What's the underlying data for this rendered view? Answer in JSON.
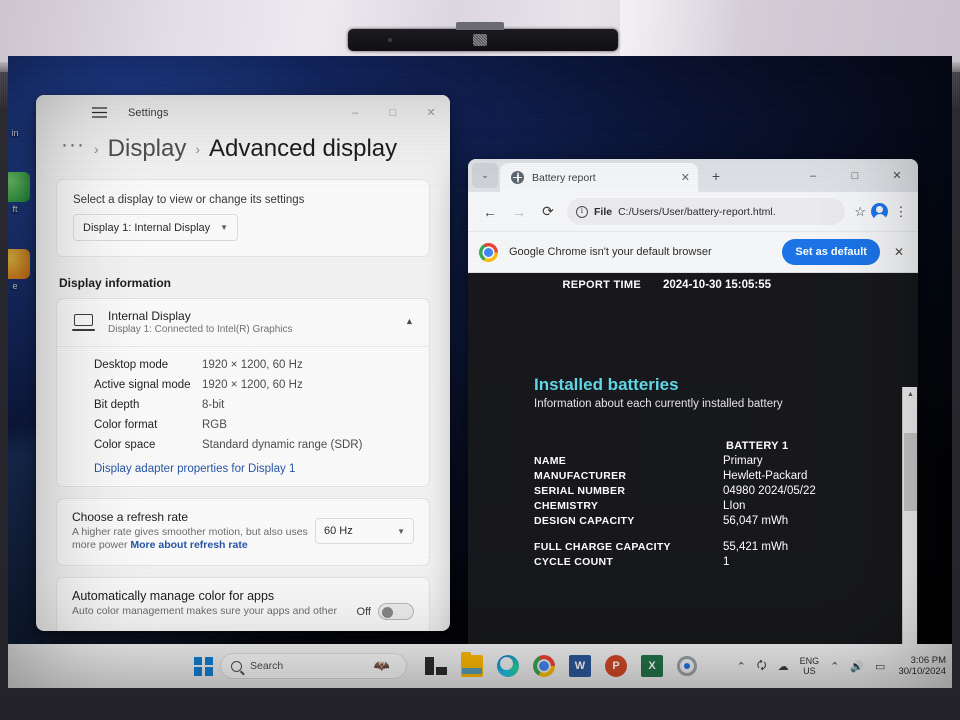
{
  "settings": {
    "window_title": "Settings",
    "back_icon": "back-arrow-icon",
    "hamburger_icon": "hamburger-menu-icon",
    "minimize": "–",
    "maximize": "□",
    "close": "✕",
    "breadcrumb": {
      "dots": "···",
      "sep1": "›",
      "parent": "Display",
      "sep2": "›",
      "current": "Advanced display"
    },
    "select_hint": "Select a display to view or change its settings",
    "display_select_value": "Display 1: Internal Display",
    "section_title": "Display information",
    "display_name": "Internal Display",
    "display_sub": "Display 1: Connected to Intel(R) Graphics",
    "info_rows": [
      {
        "key": "Desktop mode",
        "value": "1920 × 1200, 60 Hz"
      },
      {
        "key": "Active signal mode",
        "value": "1920 × 1200, 60 Hz"
      },
      {
        "key": "Bit depth",
        "value": "8-bit"
      },
      {
        "key": "Color format",
        "value": "RGB"
      },
      {
        "key": "Color space",
        "value": "Standard dynamic range (SDR)"
      }
    ],
    "adapter_link": "Display adapter properties for Display 1",
    "refresh_title": "Choose a refresh rate",
    "refresh_desc": "A higher rate gives smoother motion, but also uses more power",
    "refresh_link": "More about refresh rate",
    "refresh_value": "60 Hz",
    "auto_title": "Automatically manage color for apps",
    "auto_desc": "Auto color management makes sure your apps and other",
    "auto_toggle_label": "Off"
  },
  "chrome": {
    "tab_title": "Battery report",
    "tab_close": "✕",
    "new_tab": "+",
    "tab_list_chevron": "⌄",
    "minimize": "–",
    "maximize": "□",
    "close": "✕",
    "back": "←",
    "forward": "→",
    "reload": "⟳",
    "file_label": "File",
    "url": "C:/Users/User/battery-report.html.",
    "bookmark_star": "☆",
    "kebab": "⋮",
    "infobar_text": "Google Chrome isn't your default browser",
    "infobar_button": "Set as default",
    "infobar_close": "✕"
  },
  "battery_report": {
    "report_time_label": "REPORT TIME",
    "report_time_value": "2024-10-30  15:05:55",
    "section_title": "Installed batteries",
    "section_subtitle": "Information about each currently installed battery",
    "battery_column_header": "BATTERY 1",
    "rows": [
      {
        "key": "NAME",
        "value": "Primary"
      },
      {
        "key": "MANUFACTURER",
        "value": "Hewlett-Packard"
      },
      {
        "key": "SERIAL NUMBER",
        "value": "04980 2024/05/22"
      },
      {
        "key": "CHEMISTRY",
        "value": "LIon"
      },
      {
        "key": "DESIGN CAPACITY",
        "value": "56,047 mWh"
      }
    ],
    "rows2": [
      {
        "key": "FULL CHARGE CAPACITY",
        "value": "55,421 mWh"
      },
      {
        "key": "CYCLE COUNT",
        "value": "1"
      }
    ],
    "accent_color": "#5fd8e8",
    "background_color": "#15161a"
  },
  "desktop": {
    "icons": [
      {
        "name": "recycle-bin",
        "label": "in"
      },
      {
        "name": "green-app",
        "label": "ft"
      },
      {
        "name": "orange-app",
        "label": "e"
      }
    ]
  },
  "taskbar": {
    "start_icon": "windows-logo-icon",
    "search_placeholder": "Search",
    "search_icon": "search-icon",
    "mascot_icon": "bat-mascot-icon",
    "apps": [
      {
        "name": "task-view-icon",
        "label": ""
      },
      {
        "name": "file-explorer-icon",
        "label": ""
      },
      {
        "name": "microsoft-edge-icon",
        "label": ""
      },
      {
        "name": "google-chrome-icon",
        "label": ""
      },
      {
        "name": "microsoft-word-icon",
        "label": "W"
      },
      {
        "name": "microsoft-powerpoint-icon",
        "label": "P"
      },
      {
        "name": "microsoft-excel-icon",
        "label": "X"
      },
      {
        "name": "settings-gear-icon",
        "label": ""
      }
    ],
    "tray": {
      "chevron": "⌃",
      "sync_icon": "sync-icon",
      "onedrive_icon": "onedrive-icon",
      "lang_line1": "ENG",
      "lang_line2": "US",
      "wifi_icon": "wifi-icon",
      "volume_icon": "volume-icon",
      "battery_icon": "battery-icon",
      "time": "3:06 PM",
      "date": "30/10/2024"
    }
  }
}
